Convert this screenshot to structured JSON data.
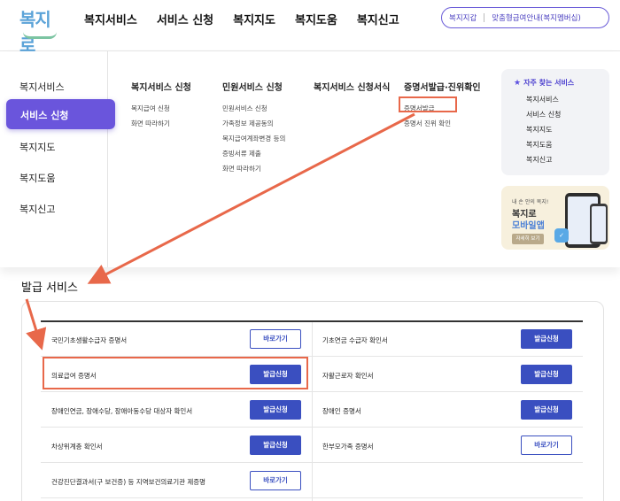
{
  "header": {
    "logo_text": "복지로",
    "nav": [
      "복지서비스",
      "서비스 신청",
      "복지지도",
      "복지도움",
      "복지신고"
    ],
    "util_links": [
      "복지지갑",
      "맞춤형급여안내(복지멤버십)"
    ]
  },
  "mega_menu": {
    "sidebar": {
      "items": [
        "복지서비스",
        "서비스 신청",
        "복지지도",
        "복지도움",
        "복지신고"
      ],
      "active": "서비스 신청"
    },
    "columns": [
      {
        "title": "복지서비스 신청",
        "links": [
          "복지급여 신청",
          "화면 따라하기"
        ]
      },
      {
        "title": "민원서비스 신청",
        "links": [
          "민원서비스 신청",
          "가족정보 제공동의",
          "복지급여계좌변경 등의",
          "증빙서류 제출",
          "화면 따라하기"
        ]
      },
      {
        "title": "복지서비스 신청서식",
        "links": []
      },
      {
        "title": "증명서발급·진위확인",
        "links": [
          "증명서발급",
          "증명서 진위 확인"
        ]
      }
    ],
    "faq": {
      "title": "자주 찾는 서비스",
      "items": [
        "복지서비스",
        "서비스 신청",
        "복지지도",
        "복지도움",
        "복지신고"
      ]
    },
    "app_banner": {
      "small": "내 손 안의 복지!",
      "title1": "복지로",
      "title2": "모바일앱",
      "button": "자세히 보기"
    }
  },
  "issue_section": {
    "title": "발급 서비스",
    "rows": [
      {
        "left": {
          "label": "국민기초생활수급자 증명서",
          "button": "바로가기",
          "style": "line"
        },
        "right": {
          "label": "기초연금 수급자 확인서",
          "button": "발급신청",
          "style": "fill"
        }
      },
      {
        "left": {
          "label": "의료급여 증명서",
          "button": "발급신청",
          "style": "fill"
        },
        "right": {
          "label": "자활근로자 확인서",
          "button": "발급신청",
          "style": "fill"
        }
      },
      {
        "left": {
          "label": "장애인연금, 장애수당, 장애아동수당 대상자 확인서",
          "button": "발급신청",
          "style": "fill"
        },
        "right": {
          "label": "장애인 증명서",
          "button": "발급신청",
          "style": "fill"
        }
      },
      {
        "left": {
          "label": "차상위계층 확인서",
          "button": "발급신청",
          "style": "fill"
        },
        "right": {
          "label": "한부모가족 증명서",
          "button": "바로가기",
          "style": "line"
        }
      },
      {
        "left": {
          "label": "건강진단결과서(구 보건증) 등 지역보건의료기관 제증명",
          "button": "바로가기",
          "style": "line"
        },
        "right": null
      }
    ]
  },
  "colors": {
    "accent_purple": "#6a55dc",
    "button_blue": "#3a4fc0",
    "highlight_red": "#e8684a"
  }
}
